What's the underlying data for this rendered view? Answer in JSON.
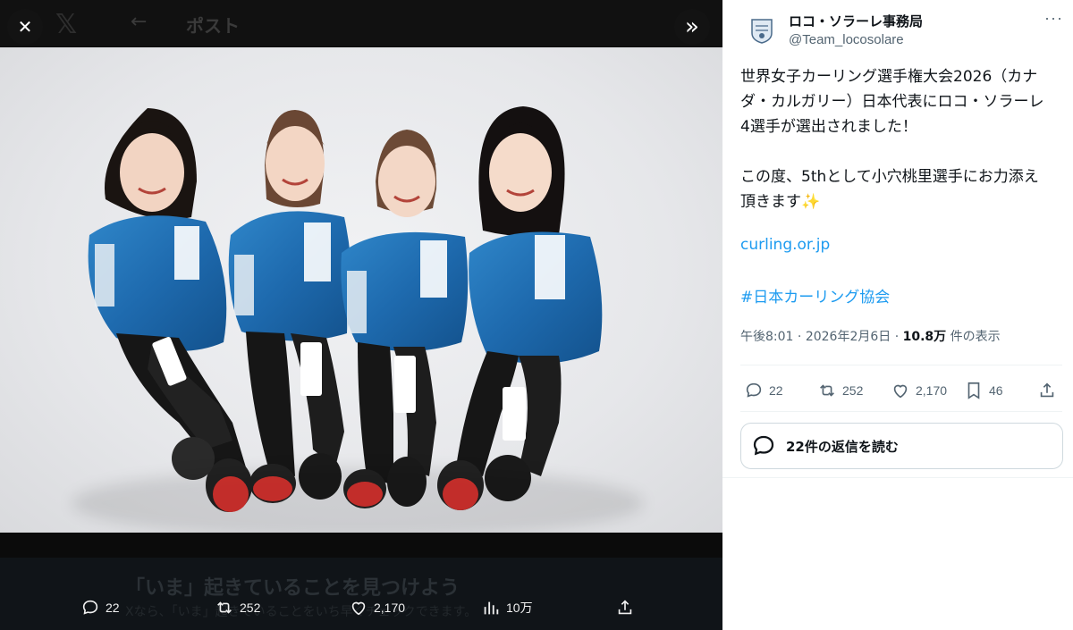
{
  "viewer": {
    "bg_header_title": "ポスト",
    "bg_back_glyph": "←",
    "bg_logo_glyph": "𝕏",
    "close_glyph": "✕",
    "expand_glyph": "»",
    "promo_title": "「いま」起きていることを見つけよう",
    "promo_sub": "Xなら、「いま」起きていることをいち早くチェックできます。",
    "actions": {
      "replies": "22",
      "reposts": "252",
      "likes": "2,170",
      "views": "10万"
    },
    "icons": {
      "reply": "speech-bubble-icon",
      "repost": "repost-arrows-icon",
      "like": "heart-icon",
      "views": "bar-chart-icon",
      "share": "share-upload-icon"
    }
  },
  "tweet": {
    "display_name": "ロコ・ソラーレ事務局",
    "handle": "@Team_locosolare",
    "more_glyph": "···",
    "paragraph1": "世界女子カーリング選手権大会2026（カナ\nダ・カルガリー）日本代表にロコ・ソラーレ\n4選手が選出されました！",
    "paragraph2_line1": "この度、5thとして小穴桃里選手にお力添え",
    "paragraph2_line2": "頂きます",
    "sparkle": "✨",
    "link": "curling.or.jp",
    "hashtag": "#日本カーリング協会",
    "time": "午後8:01",
    "date": "2026年2月6日",
    "views_count": "10.8万",
    "views_label": "件の表示",
    "dot": "·",
    "actions": {
      "replies": "22",
      "reposts": "252",
      "likes": "2,170",
      "bookmarks": "46"
    },
    "read_replies_label": "22件の返信を読む"
  },
  "colors": {
    "accent_link": "#1d9bf0",
    "text_primary": "#0f1419",
    "text_secondary": "#536471",
    "jacket_blue": "#1f6fb3",
    "shoe_red": "#d8332f"
  }
}
